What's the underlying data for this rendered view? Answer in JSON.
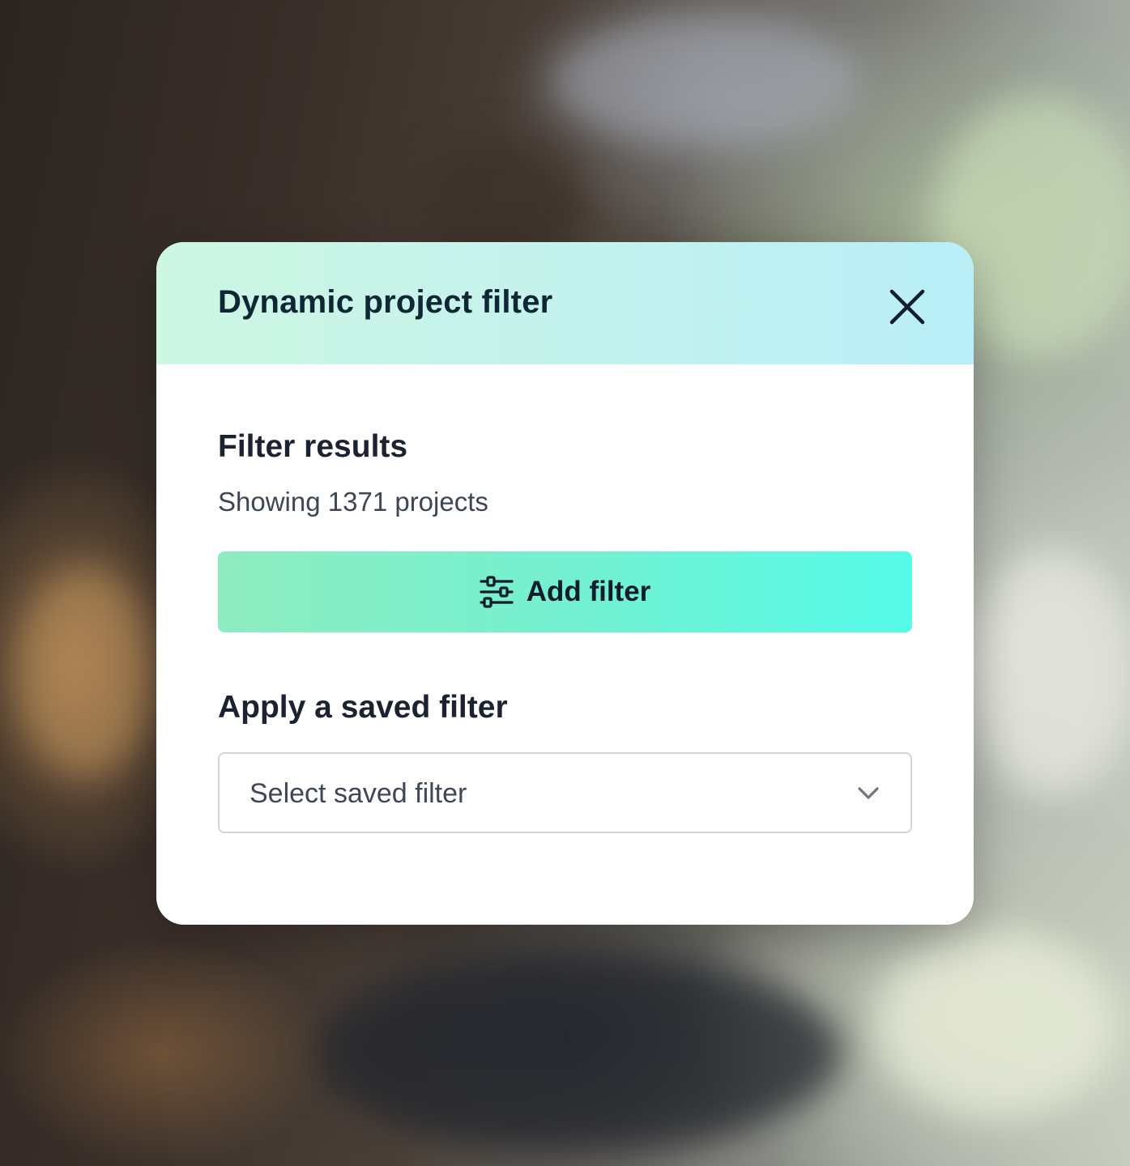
{
  "modal": {
    "title": "Dynamic project filter",
    "close_icon": "close-icon"
  },
  "filter_results": {
    "title": "Filter results",
    "count_text": "Showing 1371 projects",
    "add_button_label": "Add filter",
    "add_button_icon": "sliders-icon"
  },
  "saved_filter": {
    "title": "Apply a saved filter",
    "placeholder": "Select saved filter",
    "dropdown_icon": "chevron-down-icon"
  },
  "colors": {
    "header_gradient_start": "#cdf7e3",
    "header_gradient_end": "#b9eef7",
    "button_gradient_start": "#8eedc0",
    "button_gradient_end": "#55fbe8",
    "title_text": "#0f2735"
  }
}
